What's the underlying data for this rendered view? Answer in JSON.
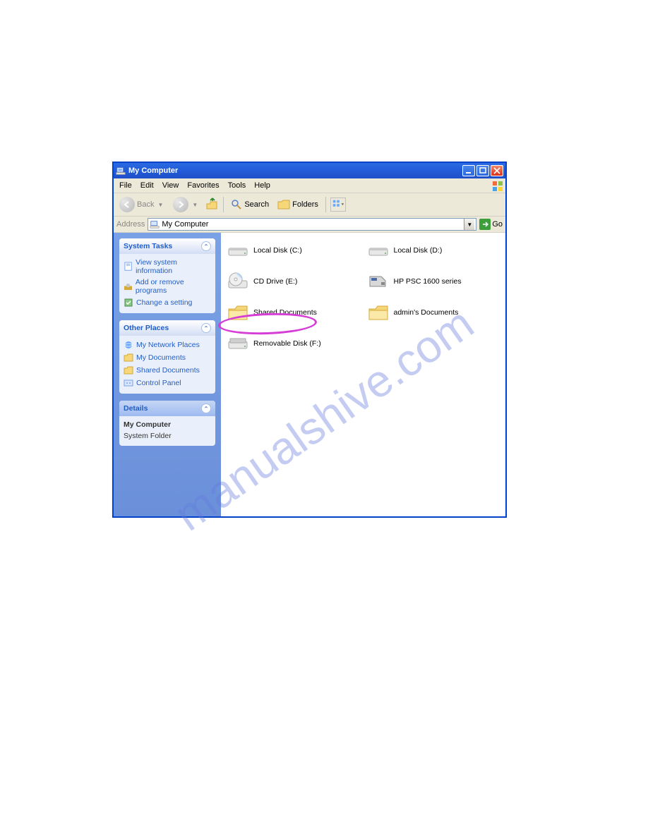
{
  "watermark": "manualshive.com",
  "window": {
    "title": "My Computer",
    "menu": [
      "File",
      "Edit",
      "View",
      "Favorites",
      "Tools",
      "Help"
    ],
    "toolbar": {
      "back": "Back",
      "search": "Search",
      "folders": "Folders"
    },
    "address": {
      "label": "Address",
      "value": "My Computer",
      "go": "Go"
    },
    "sidebar": {
      "panels": [
        {
          "title": "System Tasks",
          "links": [
            {
              "icon": "info-icon",
              "label": "View system information"
            },
            {
              "icon": "programs-icon",
              "label": "Add or remove programs"
            },
            {
              "icon": "setting-icon",
              "label": "Change a setting"
            }
          ]
        },
        {
          "title": "Other Places",
          "links": [
            {
              "icon": "network-icon",
              "label": "My Network Places"
            },
            {
              "icon": "docs-icon",
              "label": "My Documents"
            },
            {
              "icon": "folder-icon",
              "label": "Shared Documents"
            },
            {
              "icon": "control-icon",
              "label": "Control Panel"
            }
          ]
        },
        {
          "title": "Details",
          "details": {
            "name": "My Computer",
            "type": "System Folder"
          }
        }
      ]
    },
    "content": {
      "items": [
        {
          "icon": "hdd-icon",
          "label": "Local Disk (C:)"
        },
        {
          "icon": "hdd-icon",
          "label": "Local Disk (D:)"
        },
        {
          "icon": "cd-icon",
          "label": "CD Drive (E:)"
        },
        {
          "icon": "device-icon",
          "label": "HP PSC 1600 series"
        },
        {
          "icon": "folder-icon",
          "label": "Shared Documents"
        },
        {
          "icon": "folder-icon",
          "label": "admin's Documents"
        },
        {
          "icon": "removable-icon",
          "label": "Removable Disk (F:)",
          "highlighted": true
        }
      ]
    }
  }
}
